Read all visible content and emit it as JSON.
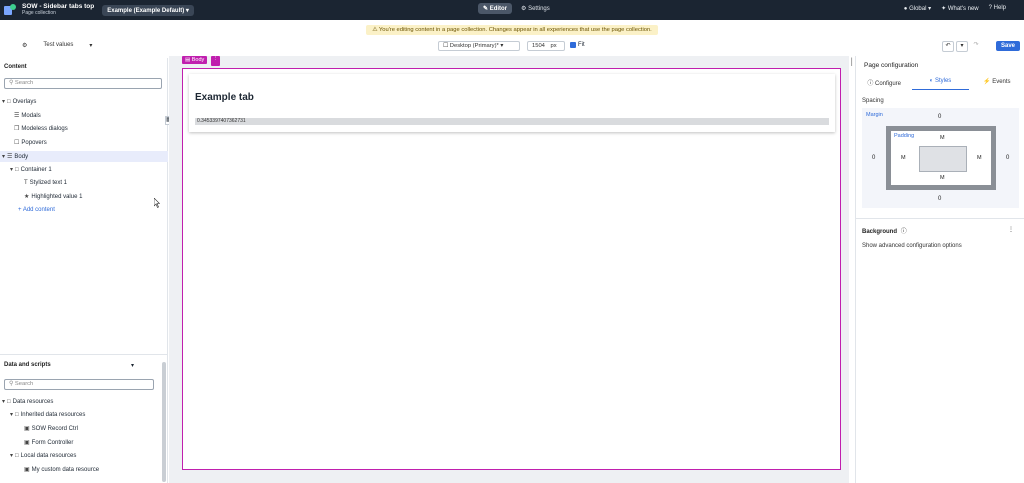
{
  "app": {
    "title": "SOW - Sidebar tabs top",
    "subtitle": "Page collection",
    "experience": "Example (Example Default) ▾"
  },
  "nav": {
    "editor": "✎ Editor",
    "settings": "⚙ Settings",
    "global": "● Global ▾",
    "whats_new": "✦ What's new",
    "help": "? Help"
  },
  "notice": "⚠ You're editing content in a page collection. Changes appear in all experiences that use the page collection.",
  "toolbar": {
    "test_values": "Test values",
    "test_values_caret": "▾",
    "test_values_icon": "⚙",
    "device": "☐ Desktop (Primary)* ▾",
    "width": "1504",
    "unit": "px",
    "fit": "Fit",
    "save": "Save",
    "undo": "↶",
    "undo_menu": "▾",
    "redo": "↷"
  },
  "left": {
    "content_header": "Content",
    "search_placeholder": "Search",
    "tree": [
      {
        "label": "Overlays",
        "icon": "□",
        "caret": "▾"
      },
      {
        "label": "Modals",
        "icon": "☰"
      },
      {
        "label": "Modeless dialogs",
        "icon": "❐"
      },
      {
        "label": "Popovers",
        "icon": "☐"
      },
      {
        "label": "Body",
        "icon": "☰",
        "caret": "▾"
      },
      {
        "label": "Container 1",
        "icon": "□",
        "caret": "▾"
      },
      {
        "label": "Stylized text 1",
        "icon": "T"
      },
      {
        "label": "Highlighted value 1",
        "icon": "★"
      }
    ],
    "add_content": "+ Add content",
    "data_header": "Data and scripts",
    "data_search_placeholder": "Search",
    "data_tree": [
      {
        "label": "Data resources",
        "icon": "□",
        "caret": "▾"
      },
      {
        "label": "Inherited data resources",
        "icon": "□",
        "caret": "▾"
      },
      {
        "label": "SOW Record Ctrl",
        "icon": "▣"
      },
      {
        "label": "Form Controller",
        "icon": "▣"
      },
      {
        "label": "Local data resources",
        "icon": "□",
        "caret": "▾"
      },
      {
        "label": "My custom data resource",
        "icon": "▣"
      }
    ]
  },
  "canvas": {
    "body_tag": "▤ Body",
    "body_tag_menu": "⋮",
    "widget_title": "Example tab",
    "widget_value": "0.3453397407362731"
  },
  "right": {
    "title": "Page configuration",
    "collapse_icon": "│",
    "tabs": [
      "ⓘ Configure",
      "◐ Styles",
      "⚡ Events"
    ],
    "spacing": "Spacing",
    "margin": "Margin",
    "margin_values": {
      "top": "0",
      "right": "0",
      "bottom": "0",
      "left": "0"
    },
    "padding": "Padding",
    "padding_values": {
      "top": "M",
      "right": "M",
      "bottom": "M",
      "left": "M"
    },
    "background": "Background",
    "background_info_icon": "ⓘ",
    "background_menu": "⋮",
    "advanced": "Show advanced configuration options"
  },
  "colors": {
    "topbar": "#1b2532",
    "accent": "#2f6bd9",
    "selection": "#c01fae",
    "notice_bg": "#fbf1c7"
  }
}
